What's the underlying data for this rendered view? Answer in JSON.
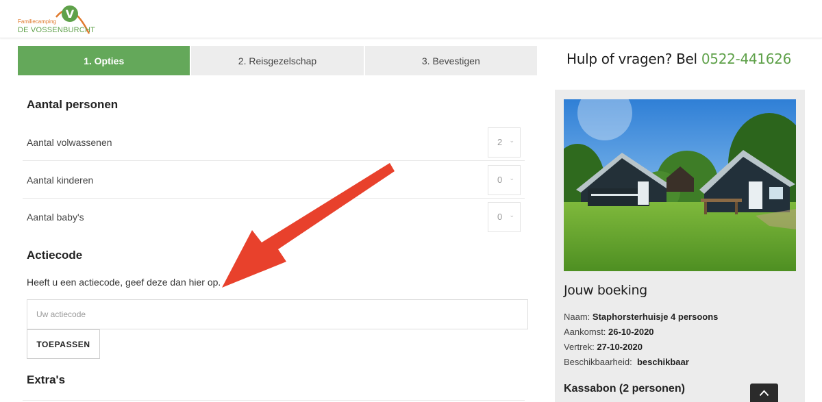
{
  "header": {
    "logo_small": "Familiecamping",
    "logo_big": "DE VOSSENBURCHT",
    "logo_letter": "V"
  },
  "steps": [
    {
      "label": "1. Opties",
      "active": true
    },
    {
      "label": "2. Reisgezelschap",
      "active": false
    },
    {
      "label": "3. Bevestigen",
      "active": false
    }
  ],
  "help": {
    "text": "Hulp of vragen? Bel ",
    "phone": "0522-441626"
  },
  "persons": {
    "heading": "Aantal personen",
    "rows": [
      {
        "label": "Aantal volwassenen",
        "value": "2"
      },
      {
        "label": "Aantal kinderen",
        "value": "0"
      },
      {
        "label": "Aantal baby's",
        "value": "0"
      }
    ]
  },
  "promo": {
    "heading": "Actiecode",
    "description": "Heeft u een actiecode, geef deze dan hier op.",
    "placeholder": "Uw actiecode",
    "button": "TOEPASSEN"
  },
  "extras": {
    "heading": "Extra's"
  },
  "booking": {
    "title": "Jouw boeking",
    "name_label": "Naam: ",
    "name_value": "Staphorsterhuisje 4 persoons",
    "arrival_label": "Aankomst: ",
    "arrival_value": "26-10-2020",
    "departure_label": "Vertrek: ",
    "departure_value": "27-10-2020",
    "availability_label": "Beschikbaarheid:  ",
    "availability_value": "beschikbaar"
  },
  "receipt": {
    "heading": "Kassabon (2 personen)"
  },
  "colors": {
    "brand_green": "#64a85a",
    "logo_orange": "#e07a2e",
    "arrow_red": "#e8412c"
  }
}
